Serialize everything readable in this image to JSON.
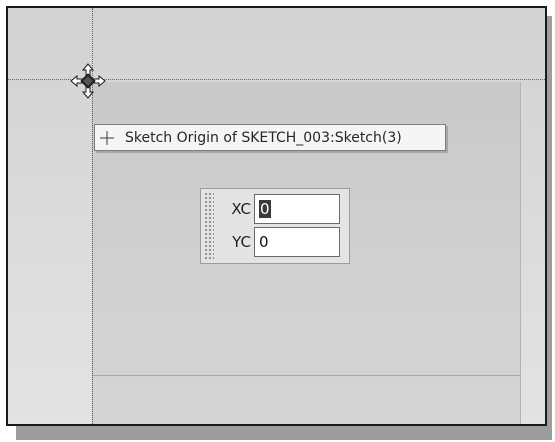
{
  "tooltip": {
    "text": "Sketch Origin of SKETCH_003:Sketch(3)",
    "icon": "sketch-origin-crosshair-icon"
  },
  "cursor": {
    "icon": "move-cursor-icon"
  },
  "coordinate_input": {
    "fields": [
      {
        "label": "XC",
        "value": "0",
        "selected": true
      },
      {
        "label": "YC",
        "value": "0",
        "selected": false
      }
    ]
  },
  "colors": {
    "viewport_background": "#d6d6d6",
    "sheet_background": "#cdcdcd",
    "tooltip_background": "#f5f5f5",
    "selection_highlight": "#3a3a3a"
  }
}
